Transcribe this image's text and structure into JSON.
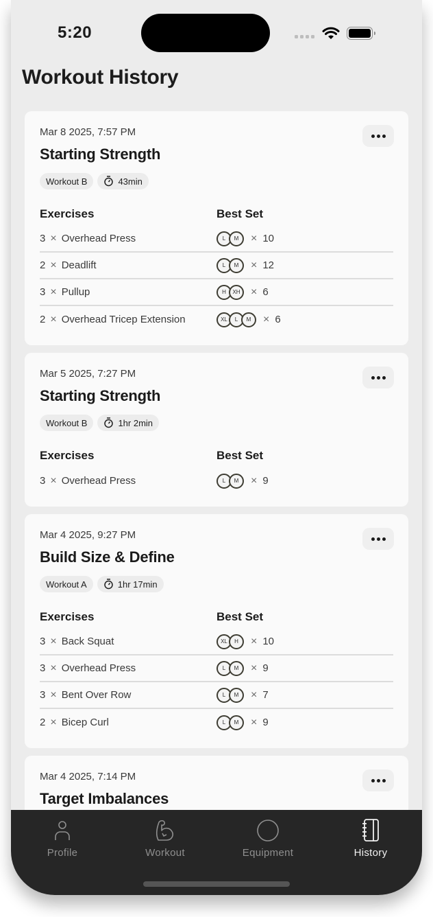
{
  "status_bar": {
    "time": "5:20"
  },
  "header": {
    "title": "Workout History"
  },
  "table_headers": {
    "exercises": "Exercises",
    "best_set": "Best Set"
  },
  "times_symbol": "×",
  "cards": [
    {
      "date": "Mar 8 2025, 7:57 PM",
      "title": "Starting Strength",
      "workout_tag": "Workout B",
      "duration": "43min",
      "exercises": [
        {
          "sets": "3",
          "name": "Overhead Press",
          "plates": [
            "L",
            "M"
          ],
          "reps": "10"
        },
        {
          "sets": "2",
          "name": "Deadlift",
          "plates": [
            "L",
            "M"
          ],
          "reps": "12"
        },
        {
          "sets": "3",
          "name": "Pullup",
          "plates": [
            "H",
            "XH"
          ],
          "reps": "6"
        },
        {
          "sets": "2",
          "name": "Overhead Tricep Extension",
          "plates": [
            "XL",
            "L",
            "M"
          ],
          "reps": "6"
        }
      ]
    },
    {
      "date": "Mar 5 2025, 7:27 PM",
      "title": "Starting Strength",
      "workout_tag": "Workout B",
      "duration": "1hr 2min",
      "exercises": [
        {
          "sets": "3",
          "name": "Overhead Press",
          "plates": [
            "L",
            "M"
          ],
          "reps": "9"
        }
      ]
    },
    {
      "date": "Mar 4 2025, 9:27 PM",
      "title": "Build Size & Define",
      "workout_tag": "Workout A",
      "duration": "1hr 17min",
      "exercises": [
        {
          "sets": "3",
          "name": "Back Squat",
          "plates": [
            "XL",
            "H"
          ],
          "reps": "10"
        },
        {
          "sets": "3",
          "name": "Overhead Press",
          "plates": [
            "L",
            "M"
          ],
          "reps": "9"
        },
        {
          "sets": "3",
          "name": "Bent Over Row",
          "plates": [
            "L",
            "M"
          ],
          "reps": "7"
        },
        {
          "sets": "2",
          "name": "Bicep Curl",
          "plates": [
            "L",
            "M"
          ],
          "reps": "9"
        }
      ]
    },
    {
      "date": "Mar 4 2025, 7:14 PM",
      "title": "Target Imbalances"
    }
  ],
  "tabbar": {
    "items": [
      {
        "label": "Profile",
        "icon": "person-icon",
        "active": false
      },
      {
        "label": "Workout",
        "icon": "flexed-bicep-icon",
        "active": false
      },
      {
        "label": "Equipment",
        "icon": "circle-icon",
        "active": false
      },
      {
        "label": "History",
        "icon": "notebook-icon",
        "active": true
      }
    ]
  },
  "colors": {
    "background": "#ececec",
    "card": "#fafafa",
    "tabbar": "#262626",
    "tab_active": "#f2f2f2",
    "tab_inactive": "#8f8f8f",
    "plate_border": "#3e3d33"
  }
}
